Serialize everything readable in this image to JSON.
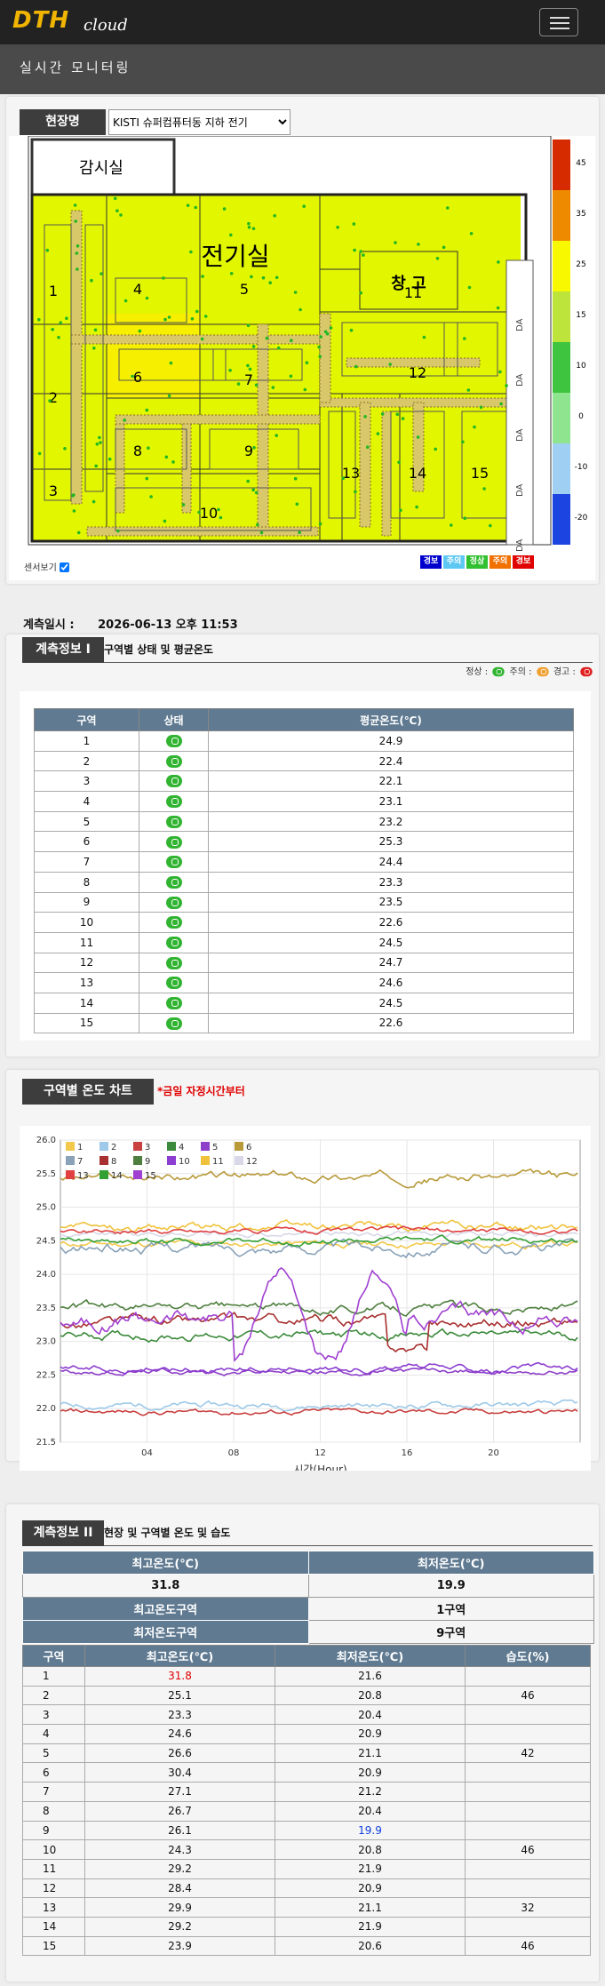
{
  "brand": {
    "name": "DTH",
    "suffix": "cloud"
  },
  "page": {
    "title": "실시간  모니터링"
  },
  "site": {
    "label": "현장명",
    "selected": "KISTI 슈퍼컴퓨터동 지하 전기"
  },
  "floorplan": {
    "rooms": {
      "control": "감시실",
      "electric": "전기실",
      "storage": "창 고"
    },
    "zones": [
      "1",
      "2",
      "3",
      "4",
      "5",
      "6",
      "7",
      "8",
      "9",
      "10",
      "11",
      "12",
      "13",
      "14",
      "15"
    ],
    "scale": [
      "45",
      "35",
      "25",
      "15",
      "10",
      "0",
      "-10",
      "-20"
    ],
    "scale_colors": [
      "#d62a00",
      "#ee8a00",
      "#f8f800",
      "#bde43a",
      "#3fc43f",
      "#8fe58f",
      "#9fcff2",
      "#1c44e0"
    ],
    "door_labels": [
      "DA",
      "DA",
      "DA",
      "DA",
      "DA"
    ],
    "sensor_toggle": "센서보기",
    "status_legend": [
      {
        "label": "경보",
        "color": "#0000cc"
      },
      {
        "label": "주의",
        "color": "#5fc8f2"
      },
      {
        "label": "정상",
        "color": "#30c030"
      },
      {
        "label": "주의",
        "color": "#f07000"
      },
      {
        "label": "경보",
        "color": "#e00000"
      }
    ]
  },
  "measure": {
    "label": "계측일시 :",
    "datetime": "2026-06-13 오후 11:53"
  },
  "info1": {
    "tag": "계측정보 I",
    "note": "구역별 상태 및 평균온도",
    "legend": {
      "normal": "정상 :",
      "caution": "주의 :",
      "warning": "경고 :"
    },
    "headers": [
      "구역",
      "상태",
      "평균온도(℃)"
    ],
    "rows": [
      [
        "1",
        "24.9"
      ],
      [
        "2",
        "22.4"
      ],
      [
        "3",
        "22.1"
      ],
      [
        "4",
        "23.1"
      ],
      [
        "5",
        "23.2"
      ],
      [
        "6",
        "25.3"
      ],
      [
        "7",
        "24.4"
      ],
      [
        "8",
        "23.3"
      ],
      [
        "9",
        "23.5"
      ],
      [
        "10",
        "22.6"
      ],
      [
        "11",
        "24.5"
      ],
      [
        "12",
        "24.7"
      ],
      [
        "13",
        "24.6"
      ],
      [
        "14",
        "24.5"
      ],
      [
        "15",
        "22.6"
      ]
    ]
  },
  "chart": {
    "tag": "구역별 온도 차트",
    "note": "*금일 자정시간부터"
  },
  "chart_data": {
    "type": "line",
    "xlabel": "시간(Hour)",
    "ylabel": "",
    "xlim": [
      0,
      24
    ],
    "ylim": [
      21.5,
      26.0
    ],
    "xticks": [
      "04",
      "08",
      "12",
      "16",
      "20"
    ],
    "xtick_values": [
      4,
      8,
      12,
      16,
      20
    ],
    "yticks": [
      "26.0",
      "25.5",
      "25.0",
      "24.5",
      "24.0",
      "23.5",
      "23.0",
      "22.5",
      "22.0",
      "21.5"
    ],
    "series": [
      {
        "name": "1",
        "color": "#f2c94c",
        "level": 24.45,
        "noise": 0.06
      },
      {
        "name": "2",
        "color": "#9ec9e8",
        "level": 22.05,
        "noise": 0.06
      },
      {
        "name": "3",
        "color": "#c94040",
        "level": 21.95,
        "noise": 0.05
      },
      {
        "name": "4",
        "color": "#3c8a3c",
        "level": 23.1,
        "noise": 0.08
      },
      {
        "name": "5",
        "color": "#8e3fc9",
        "level": 22.55,
        "noise": 0.05
      },
      {
        "name": "6",
        "color": "#b89a3a",
        "level": 25.45,
        "noise": 0.08
      },
      {
        "name": "7",
        "color": "#8aa2b8",
        "level": 24.4,
        "noise": 0.1
      },
      {
        "name": "8",
        "color": "#a83030",
        "level": 23.3,
        "noise": 0.1
      },
      {
        "name": "9",
        "color": "#4e7f3e",
        "level": 23.5,
        "noise": 0.08
      },
      {
        "name": "10",
        "color": "#8b3ecf",
        "level": 22.6,
        "noise": 0.06
      },
      {
        "name": "11",
        "color": "#f0c23c",
        "level": 24.7,
        "noise": 0.08
      },
      {
        "name": "12",
        "color": "#d8d8e8",
        "level": 24.6,
        "noise": 0.05
      },
      {
        "name": "13",
        "color": "#e04040",
        "level": 24.65,
        "noise": 0.05
      },
      {
        "name": "14",
        "color": "#34a034",
        "level": 24.5,
        "noise": 0.06
      },
      {
        "name": "15",
        "color": "#a040d0",
        "level": 23.35,
        "noise": 0.15
      }
    ]
  },
  "info2": {
    "tag": "계측정보 II",
    "note": "현장 및 구역별 온도 및 습도",
    "summary_headers": [
      "최고온도(℃)",
      "최저온도(℃)"
    ],
    "summary_values": [
      "31.8",
      "19.9"
    ],
    "max_zone_label": "최고온도구역",
    "max_zone": "1구역",
    "min_zone_label": "최저온도구역",
    "min_zone": "9구역",
    "headers": [
      "구역",
      "최고온도(℃)",
      "최저온도(℃)",
      "습도(%)"
    ],
    "rows": [
      [
        "1",
        "31.8",
        "21.6",
        ""
      ],
      [
        "2",
        "25.1",
        "20.8",
        "46"
      ],
      [
        "3",
        "23.3",
        "20.4",
        ""
      ],
      [
        "4",
        "24.6",
        "20.9",
        ""
      ],
      [
        "5",
        "26.6",
        "21.1",
        "42"
      ],
      [
        "6",
        "30.4",
        "20.9",
        ""
      ],
      [
        "7",
        "27.1",
        "21.2",
        ""
      ],
      [
        "8",
        "26.7",
        "20.4",
        ""
      ],
      [
        "9",
        "26.1",
        "19.9",
        ""
      ],
      [
        "10",
        "24.3",
        "20.8",
        "46"
      ],
      [
        "11",
        "29.2",
        "21.9",
        ""
      ],
      [
        "12",
        "28.4",
        "20.9",
        ""
      ],
      [
        "13",
        "29.9",
        "21.1",
        "32"
      ],
      [
        "14",
        "29.2",
        "21.9",
        ""
      ],
      [
        "15",
        "23.9",
        "20.6",
        "46"
      ]
    ]
  }
}
